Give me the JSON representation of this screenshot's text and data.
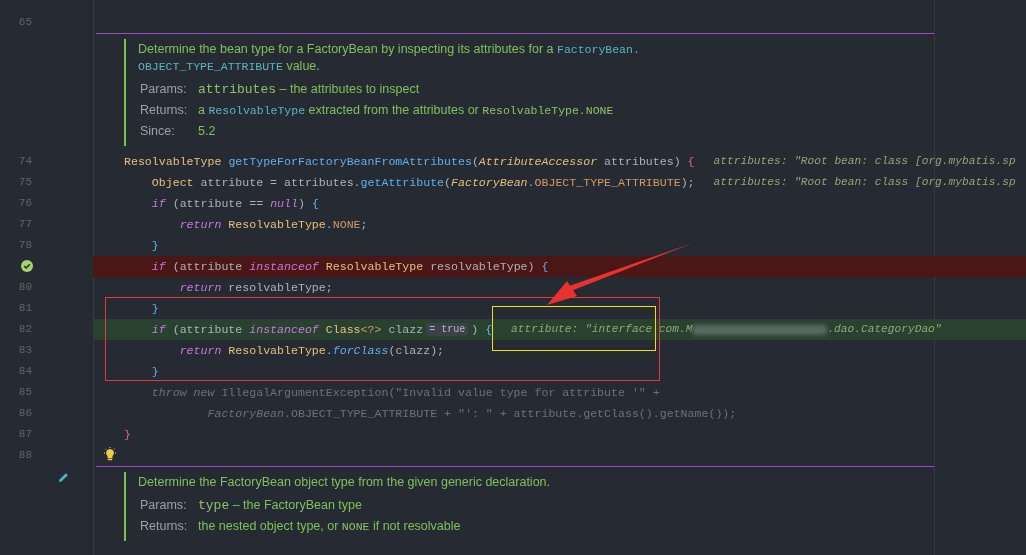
{
  "top_blank_line": {
    "number": "65"
  },
  "doc_blocks": [
    {
      "edit_icon": false,
      "description": [
        [
          {
            "kind": "text",
            "t": "Determine the bean type for a FactoryBean by inspecting its attributes for a "
          },
          {
            "kind": "link",
            "t": "FactoryBean."
          }
        ],
        [
          {
            "kind": "link",
            "t": "OBJECT_TYPE_ATTRIBUTE"
          },
          {
            "kind": "text",
            "t": " value."
          }
        ]
      ],
      "rows": [
        {
          "label": "Params:",
          "value": [
            {
              "kind": "param",
              "t": "attributes"
            },
            {
              "kind": "text",
              "t": " – the attributes to inspect"
            }
          ]
        },
        {
          "label": "Returns:",
          "value": [
            {
              "kind": "text",
              "t": "a "
            },
            {
              "kind": "link",
              "t": "ResolvableType"
            },
            {
              "kind": "text",
              "t": " extracted from the attributes or "
            },
            {
              "kind": "code",
              "t": "ResolvableType.NONE"
            }
          ]
        },
        {
          "label": "Since:",
          "value": [
            {
              "kind": "text",
              "t": "5.2"
            }
          ]
        }
      ]
    },
    {
      "edit_icon": true,
      "description": [
        [
          {
            "kind": "text",
            "t": "Determine the FactoryBean object type from the given generic declaration."
          }
        ]
      ],
      "rows": [
        {
          "label": "Params:",
          "value": [
            {
              "kind": "param",
              "t": "type"
            },
            {
              "kind": "text",
              "t": " – the FactoryBean type"
            }
          ]
        },
        {
          "label": "Returns:",
          "value": [
            {
              "kind": "text",
              "t": "the nested object type, or "
            },
            {
              "kind": "code",
              "t": "NONE"
            },
            {
              "kind": "text",
              "t": " if not resolvable"
            }
          ]
        }
      ]
    }
  ],
  "code_lines": [
    {
      "number": "74",
      "breakpoint": false,
      "current": false,
      "bulb": false,
      "tokens": [
        {
          "kind": "type",
          "t": "ResolvableType "
        },
        {
          "kind": "method",
          "t": "getTypeForFactoryBeanFromAttributes"
        },
        {
          "kind": "plain",
          "t": "("
        },
        {
          "kind": "itype",
          "t": "AttributeAccessor"
        },
        {
          "kind": "plain",
          "t": " attributes) "
        },
        {
          "kind": "brace_red",
          "t": "{"
        },
        {
          "kind": "hint",
          "t": "attributes: \"Root bean: class [org.mybatis.sp"
        }
      ]
    },
    {
      "number": "75",
      "breakpoint": false,
      "current": false,
      "bulb": false,
      "tokens": [
        {
          "kind": "type",
          "t": "    Object"
        },
        {
          "kind": "plain",
          "t": " attribute = attributes."
        },
        {
          "kind": "method",
          "t": "getAttribute"
        },
        {
          "kind": "plain",
          "t": "("
        },
        {
          "kind": "itype",
          "t": "FactoryBean"
        },
        {
          "kind": "plain",
          "t": "."
        },
        {
          "kind": "field",
          "t": "OBJECT_TYPE_ATTRIBUTE"
        },
        {
          "kind": "plain",
          "t": ");"
        },
        {
          "kind": "hint",
          "t": "attributes: \"Root bean: class [org.mybatis.sp"
        }
      ]
    },
    {
      "number": "76",
      "breakpoint": false,
      "current": false,
      "bulb": false,
      "tokens": [
        {
          "kind": "kw",
          "t": "    if"
        },
        {
          "kind": "plain",
          "t": " (attribute == "
        },
        {
          "kind": "kw",
          "t": "null"
        },
        {
          "kind": "plain",
          "t": ") "
        },
        {
          "kind": "brace_blue",
          "t": "{"
        }
      ]
    },
    {
      "number": "77",
      "breakpoint": false,
      "current": false,
      "bulb": false,
      "tokens": [
        {
          "kind": "kw",
          "t": "        return"
        },
        {
          "kind": "type",
          "t": " ResolvableType"
        },
        {
          "kind": "plain",
          "t": "."
        },
        {
          "kind": "field",
          "t": "NONE"
        },
        {
          "kind": "plain",
          "t": ";"
        }
      ]
    },
    {
      "number": "78",
      "breakpoint": false,
      "current": false,
      "bulb": false,
      "tokens": [
        {
          "kind": "brace_blue",
          "t": "    }"
        }
      ]
    },
    {
      "breakpoint": true,
      "current": false,
      "bulb": false,
      "tokens": [
        {
          "kind": "kw",
          "t": "    if"
        },
        {
          "kind": "plain",
          "t": " (attribute "
        },
        {
          "kind": "kw",
          "t": "instanceof"
        },
        {
          "kind": "type",
          "t": " ResolvableType"
        },
        {
          "kind": "plain",
          "t": " resolvableType) "
        },
        {
          "kind": "brace_blue",
          "t": "{"
        }
      ]
    },
    {
      "number": "80",
      "breakpoint": false,
      "current": false,
      "bulb": false,
      "tokens": [
        {
          "kind": "kw",
          "t": "        return"
        },
        {
          "kind": "plain",
          "t": " resolvableType;"
        }
      ]
    },
    {
      "number": "81",
      "breakpoint": false,
      "current": false,
      "bulb": false,
      "tokens": [
        {
          "kind": "brace_blue",
          "t": "    }"
        }
      ]
    },
    {
      "number": "82",
      "breakpoint": false,
      "current": true,
      "bulb": false,
      "tokens": [
        {
          "kind": "kw",
          "t": "    if"
        },
        {
          "kind": "plain",
          "t": " (attribute "
        },
        {
          "kind": "kw",
          "t": "instanceof"
        },
        {
          "kind": "type",
          "t": " Class"
        },
        {
          "kind": "field",
          "t": "<?>"
        },
        {
          "kind": "plain",
          "t": " clazz"
        },
        {
          "kind": "pill",
          "t": "= true"
        },
        {
          "kind": "plain",
          "t": ") "
        },
        {
          "kind": "brace_blue",
          "t": "{"
        },
        {
          "kind": "hint",
          "t": "attribute: \"interface com.M"
        },
        {
          "kind": "blur"
        },
        {
          "kind": "hint_cont",
          "t": ".dao.CategoryDao\""
        }
      ]
    },
    {
      "number": "83",
      "breakpoint": false,
      "current": false,
      "bulb": false,
      "tokens": [
        {
          "kind": "kw",
          "t": "        return"
        },
        {
          "kind": "type",
          "t": " ResolvableType"
        },
        {
          "kind": "plain",
          "t": "."
        },
        {
          "kind": "imethod",
          "t": "forClass"
        },
        {
          "kind": "plain",
          "t": "(clazz);"
        }
      ]
    },
    {
      "number": "84",
      "breakpoint": false,
      "current": false,
      "bulb": false,
      "tokens": [
        {
          "kind": "brace_blue",
          "t": "    }"
        }
      ]
    },
    {
      "number": "85",
      "breakpoint": false,
      "current": false,
      "bulb": false,
      "tokens": [
        {
          "kind": "dimkw",
          "t": "    throw new"
        },
        {
          "kind": "dim",
          "t": " IllegalArgumentException(\"Invalid value type for attribute '\" +"
        }
      ]
    },
    {
      "number": "86",
      "breakpoint": false,
      "current": false,
      "bulb": false,
      "tokens": [
        {
          "kind": "dimkw",
          "t": "            FactoryBean"
        },
        {
          "kind": "dim",
          "t": ".OBJECT_TYPE_ATTRIBUTE + \"': \" + attribute.getClass().getName());"
        }
      ]
    },
    {
      "number": "87",
      "breakpoint": false,
      "current": false,
      "bulb": false,
      "tokens": [
        {
          "kind": "brace_red",
          "t": "}"
        }
      ]
    },
    {
      "number": "88",
      "breakpoint": false,
      "current": false,
      "bulb": true
    }
  ],
  "annotations": [
    {
      "kind": "red_box"
    },
    {
      "kind": "yellow_box"
    },
    {
      "kind": "arrow"
    }
  ]
}
